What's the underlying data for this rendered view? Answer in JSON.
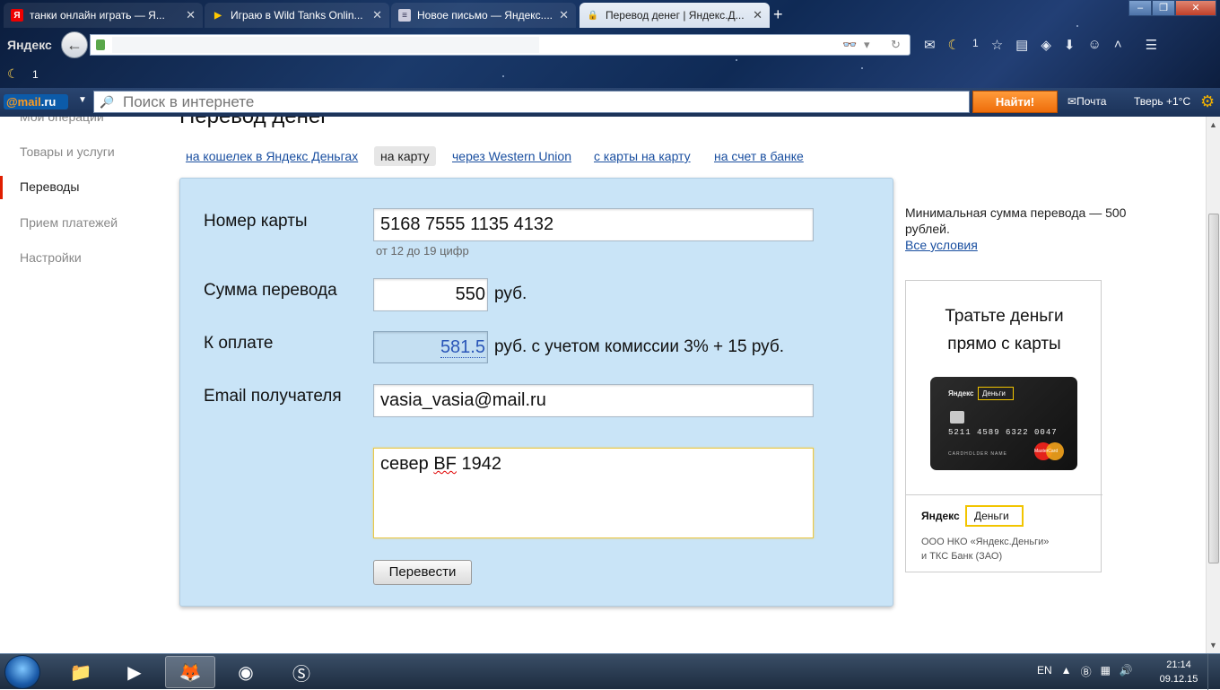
{
  "browser": {
    "tabs": [
      {
        "title": "танки онлайн играть — Я...",
        "favicon": "yandex-icon"
      },
      {
        "title": "Играю в Wild Tanks Onlin...",
        "favicon": "play-icon"
      },
      {
        "title": "Новое письмо — Яндекс....",
        "favicon": "document-icon"
      },
      {
        "title": "Перевод денег | Яндекс.Д...",
        "favicon": "lock-icon"
      }
    ],
    "brand": "Яндекс",
    "bookmark_count": "1",
    "nav_count": "1"
  },
  "mailbar": {
    "logo_prefix": "@mail",
    "logo_suffix": ".ru",
    "search_placeholder": "Поиск в интернете",
    "find_button": "Найти!",
    "mail_link": "Почта",
    "weather": "Тверь +1°C"
  },
  "sidebar": {
    "items": [
      {
        "label": "Мои операции"
      },
      {
        "label": "Товары и услуги"
      },
      {
        "label": "Переводы"
      },
      {
        "label": "Прием платежей"
      },
      {
        "label": "Настройки"
      }
    ]
  },
  "page": {
    "title": "Перевод денег"
  },
  "transfer_tabs": [
    {
      "label": "на кошелек в Яндекс Деньгах"
    },
    {
      "label": "на карту"
    },
    {
      "label": "через Western Union"
    },
    {
      "label": "с карты на карту"
    },
    {
      "label": "на счет в банке"
    }
  ],
  "form": {
    "card_label": "Номер карты",
    "card_value": "5168 7555 1135 4132",
    "card_hint": "от 12 до 19 цифр",
    "amount_label": "Сумма перевода",
    "amount_value": "550",
    "amount_unit": "руб.",
    "pay_label": "К оплате",
    "pay_value": "581.5",
    "pay_unit": "руб. с учетом комиссии 3% + 15 руб.",
    "email_label": "Email получателя",
    "email_value": "vasia_vasia@mail.ru",
    "message_prefix": "север ",
    "message_misspelled": "BF",
    "message_suffix": " 1942",
    "send_button": "Перевести"
  },
  "right_info": {
    "min_sum": "Минимальная сумма перевода — 500 рублей.",
    "all_conditions": "Все условия"
  },
  "ad": {
    "title_line1": "Тратьте деньги",
    "title_line2": "прямо с карты",
    "card_brand1": "Яндекс",
    "card_brand2": "Деньги",
    "card_number": "5211 4589 6322 0047",
    "card_holder": "CARDHOLDER NAME",
    "card_network": "MasterCard",
    "logo1": "Яндекс",
    "logo2": "Деньги",
    "legal_line1": "ООО НКО «Яндекс.Деньги»",
    "legal_line2": "и ТКС Банк (ЗАО)"
  },
  "taskbar": {
    "lang": "EN",
    "time": "21:14",
    "date": "09.12.15"
  }
}
